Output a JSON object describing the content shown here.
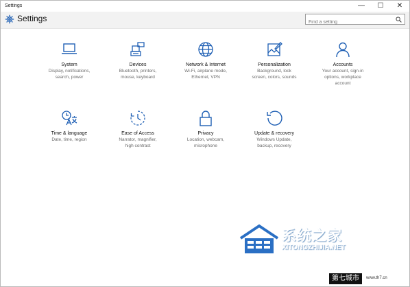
{
  "window": {
    "title": "Settings",
    "minimize_glyph": "—",
    "maximize_glyph": "☐",
    "close_glyph": "✕"
  },
  "header": {
    "title": "Settings",
    "icon": "gear-icon"
  },
  "search": {
    "placeholder": "Find a setting",
    "icon": "search-icon"
  },
  "accent_color": "#1e5fb4",
  "categories": [
    {
      "name": "System",
      "desc": [
        "Display, notifications,",
        "search, power"
      ],
      "icon": "laptop-icon"
    },
    {
      "name": "Devices",
      "desc": [
        "Bluetooth, printers,",
        "mouse, keyboard"
      ],
      "icon": "devices-icon"
    },
    {
      "name": "Network & Internet",
      "desc": [
        "Wi-Fi, airplane mode,",
        "Ethernet, VPN"
      ],
      "icon": "globe-icon"
    },
    {
      "name": "Personalization",
      "desc": [
        "Background, lock",
        "screen, colors, sounds"
      ],
      "icon": "personalization-icon"
    },
    {
      "name": "Accounts",
      "desc": [
        "Your account, sign-in",
        "options, workplace",
        "account"
      ],
      "icon": "person-icon"
    },
    {
      "name": "Time & language",
      "desc": [
        "Date, time, region"
      ],
      "icon": "time-language-icon"
    },
    {
      "name": "Ease of Access",
      "desc": [
        "Narrator, magnifier,",
        "high contrast"
      ],
      "icon": "ease-of-access-icon"
    },
    {
      "name": "Privacy",
      "desc": [
        "Location, webcam,",
        "microphone"
      ],
      "icon": "lock-icon"
    },
    {
      "name": "Update & recovery",
      "desc": [
        "Windows Update,",
        "backup, recovery"
      ],
      "icon": "refresh-icon"
    }
  ],
  "watermark": {
    "chinese": "系统之家",
    "english": "XITONGZHIJIA.NET",
    "stamp": "第七城市",
    "stamp_small": "www.th7.cn"
  }
}
